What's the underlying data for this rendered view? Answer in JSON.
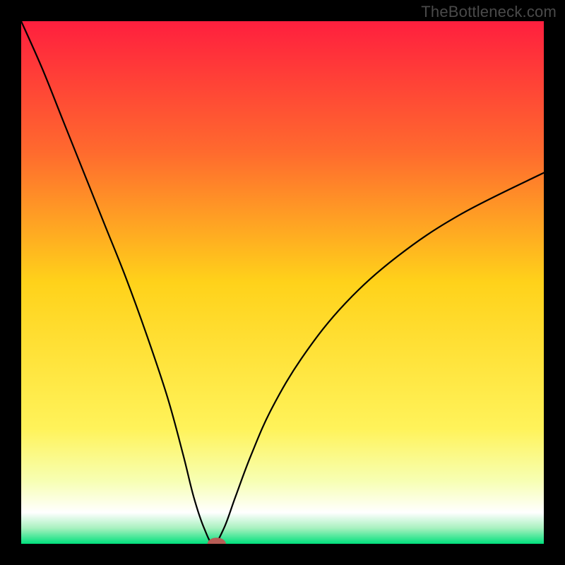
{
  "watermark": "TheBottleneck.com",
  "chart_data": {
    "type": "line",
    "title": "",
    "xlabel": "",
    "ylabel": "",
    "xlim": [
      0,
      100
    ],
    "ylim": [
      0,
      100
    ],
    "grid": false,
    "legend": false,
    "gradient_stops": [
      {
        "offset": 0.0,
        "color": "#ff1f3e"
      },
      {
        "offset": 0.25,
        "color": "#ff6a2e"
      },
      {
        "offset": 0.5,
        "color": "#ffd21a"
      },
      {
        "offset": 0.78,
        "color": "#fff35a"
      },
      {
        "offset": 0.88,
        "color": "#f7ffb3"
      },
      {
        "offset": 0.94,
        "color": "#ffffff"
      },
      {
        "offset": 0.97,
        "color": "#a8f1bf"
      },
      {
        "offset": 1.0,
        "color": "#00e07c"
      }
    ],
    "series": [
      {
        "name": "bottleneck-curve",
        "x": [
          0,
          4,
          8,
          12,
          16,
          20,
          24,
          28,
          31,
          33,
          35,
          36.8,
          38.8,
          41,
          44,
          48,
          54,
          62,
          72,
          84,
          100
        ],
        "y": [
          100,
          91,
          81,
          71,
          61,
          51,
          40,
          28,
          17,
          9,
          3,
          0,
          3,
          9,
          17,
          26,
          36,
          46,
          55,
          63,
          71
        ]
      }
    ],
    "marker": {
      "x": 37.4,
      "y": 0,
      "rx": 1.7,
      "ry": 1.1,
      "color": "#b85d56"
    }
  }
}
